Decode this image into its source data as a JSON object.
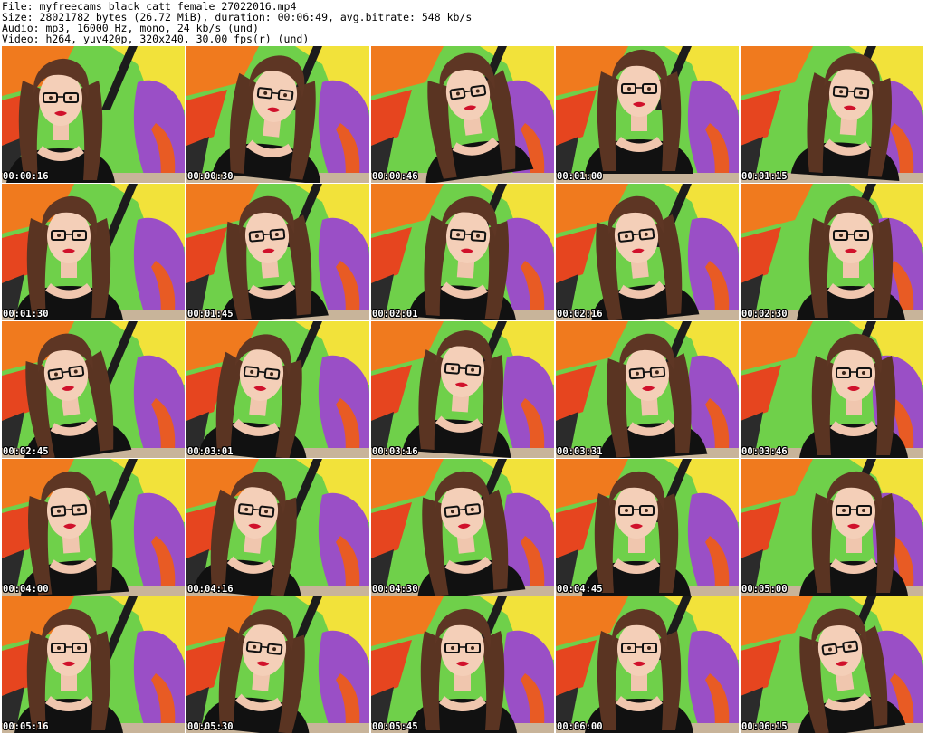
{
  "header": {
    "file": "File: myfreecams_black_catt_female_27022016.mp4",
    "size": "Size: 28021782 bytes (26.72 MiB), duration: 00:06:49, avg.bitrate: 548 kb/s",
    "audio": "Audio: mp3, 16000 Hz, mono, 24 kb/s (und)",
    "video": "Video: h264, yuv420p, 320x240, 30.00 fps(r) (und)"
  },
  "thumbnails": [
    {
      "time": "00:00:16"
    },
    {
      "time": "00:00:30"
    },
    {
      "time": "00:00:46"
    },
    {
      "time": "00:01:00"
    },
    {
      "time": "00:01:15"
    },
    {
      "time": "00:01:30"
    },
    {
      "time": "00:01:45"
    },
    {
      "time": "00:02:01"
    },
    {
      "time": "00:02:16"
    },
    {
      "time": "00:02:30"
    },
    {
      "time": "00:02:45"
    },
    {
      "time": "00:03:01"
    },
    {
      "time": "00:03:16"
    },
    {
      "time": "00:03:31"
    },
    {
      "time": "00:03:46"
    },
    {
      "time": "00:04:00"
    },
    {
      "time": "00:04:16"
    },
    {
      "time": "00:04:30"
    },
    {
      "time": "00:04:45"
    },
    {
      "time": "00:05:00"
    },
    {
      "time": "00:05:16"
    },
    {
      "time": "00:05:30"
    },
    {
      "time": "00:05:45"
    },
    {
      "time": "00:06:00"
    },
    {
      "time": "00:06:15"
    }
  ]
}
